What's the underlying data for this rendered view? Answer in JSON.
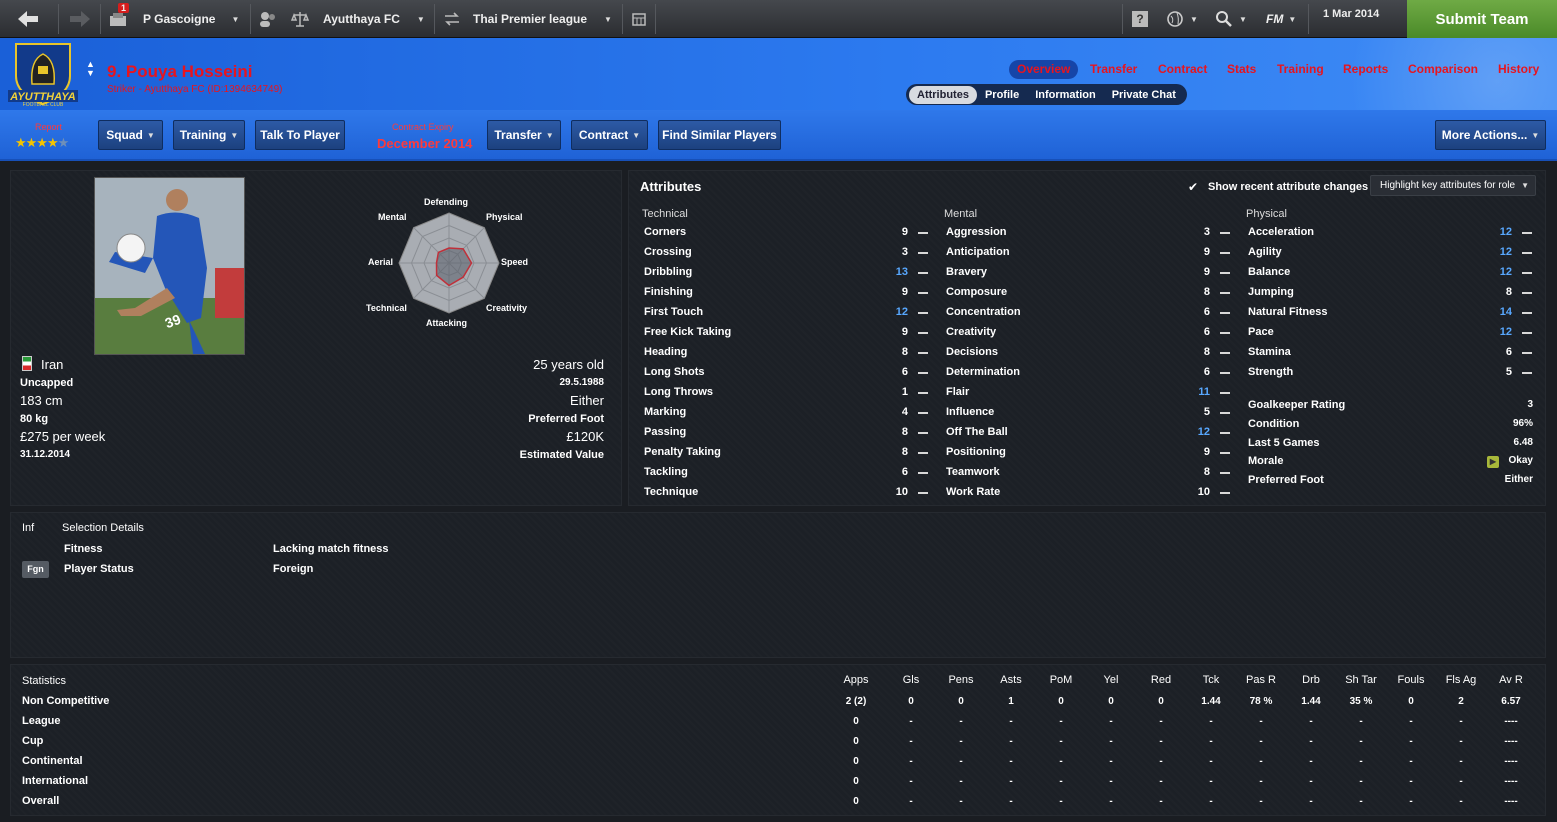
{
  "topbar": {
    "manager": "P Gascoigne",
    "club": "Ayutthaya FC",
    "competition": "Thai Premier league",
    "date": "1 Mar 2014",
    "fm_label": "FM",
    "submit": "Submit Team",
    "notification_count": "1"
  },
  "header": {
    "club_logo_text": "AYUTTHAYA",
    "club_logo_sub": "FOOTBALL CLUB",
    "player_name": "9. Pouya Hosseini",
    "player_sub": "Striker - Ayutthaya FC (ID:1394634749)",
    "tabs": [
      "Overview",
      "Transfer",
      "Contract",
      "Stats",
      "Training",
      "Reports",
      "Comparison",
      "History"
    ],
    "subtabs": [
      "Attributes",
      "Profile",
      "Information",
      "Private Chat"
    ]
  },
  "actions": {
    "report_label": "Report",
    "stars": "★★★★",
    "half_star": "★",
    "squad": "Squad",
    "training": "Training",
    "talk": "Talk To Player",
    "contract_expiry_label": "Contract Expiry",
    "contract_expiry": "December 2014",
    "transfer": "Transfer",
    "contract": "Contract",
    "similar": "Find Similar Players",
    "more": "More Actions..."
  },
  "profile": {
    "nationality": "Iran",
    "caps": "Uncapped",
    "height": "183 cm",
    "weight": "80 kg",
    "wage": "£275 per week",
    "contract_end": "31.12.2014",
    "age": "25 years old",
    "dob": "29.5.1988",
    "foot": "Either",
    "foot_label": "Preferred Foot",
    "value": "£120K",
    "value_label": "Estimated Value",
    "shirt_number": "39"
  },
  "radar": {
    "labels": [
      "Defending",
      "Physical",
      "Speed",
      "Creativity",
      "Attacking",
      "Technical",
      "Aerial",
      "Mental"
    ],
    "values": [
      0.3,
      0.4,
      0.45,
      0.4,
      0.45,
      0.35,
      0.25,
      0.3
    ]
  },
  "attributes": {
    "title": "Attributes",
    "show_changes": "Show recent attribute changes",
    "highlight": "Highlight key attributes for role",
    "technical_title": "Technical",
    "mental_title": "Mental",
    "physical_title": "Physical",
    "technical": [
      {
        "name": "Corners",
        "value": "9",
        "hl": false
      },
      {
        "name": "Crossing",
        "value": "3",
        "hl": false
      },
      {
        "name": "Dribbling",
        "value": "13",
        "hl": true
      },
      {
        "name": "Finishing",
        "value": "9",
        "hl": false
      },
      {
        "name": "First Touch",
        "value": "12",
        "hl": true
      },
      {
        "name": "Free Kick Taking",
        "value": "9",
        "hl": false
      },
      {
        "name": "Heading",
        "value": "8",
        "hl": false
      },
      {
        "name": "Long Shots",
        "value": "6",
        "hl": false
      },
      {
        "name": "Long Throws",
        "value": "1",
        "hl": false
      },
      {
        "name": "Marking",
        "value": "4",
        "hl": false
      },
      {
        "name": "Passing",
        "value": "8",
        "hl": false
      },
      {
        "name": "Penalty Taking",
        "value": "8",
        "hl": false
      },
      {
        "name": "Tackling",
        "value": "6",
        "hl": false
      },
      {
        "name": "Technique",
        "value": "10",
        "hl": false
      }
    ],
    "mental": [
      {
        "name": "Aggression",
        "value": "3",
        "hl": false
      },
      {
        "name": "Anticipation",
        "value": "9",
        "hl": false
      },
      {
        "name": "Bravery",
        "value": "9",
        "hl": false
      },
      {
        "name": "Composure",
        "value": "8",
        "hl": false
      },
      {
        "name": "Concentration",
        "value": "6",
        "hl": false
      },
      {
        "name": "Creativity",
        "value": "6",
        "hl": false
      },
      {
        "name": "Decisions",
        "value": "8",
        "hl": false
      },
      {
        "name": "Determination",
        "value": "6",
        "hl": false
      },
      {
        "name": "Flair",
        "value": "11",
        "hl": true
      },
      {
        "name": "Influence",
        "value": "5",
        "hl": false
      },
      {
        "name": "Off The Ball",
        "value": "12",
        "hl": true
      },
      {
        "name": "Positioning",
        "value": "9",
        "hl": false
      },
      {
        "name": "Teamwork",
        "value": "8",
        "hl": false
      },
      {
        "name": "Work Rate",
        "value": "10",
        "hl": false
      }
    ],
    "physical": [
      {
        "name": "Acceleration",
        "value": "12",
        "hl": true
      },
      {
        "name": "Agility",
        "value": "12",
        "hl": true
      },
      {
        "name": "Balance",
        "value": "12",
        "hl": true
      },
      {
        "name": "Jumping",
        "value": "8",
        "hl": false
      },
      {
        "name": "Natural Fitness",
        "value": "14",
        "hl": true
      },
      {
        "name": "Pace",
        "value": "12",
        "hl": true
      },
      {
        "name": "Stamina",
        "value": "6",
        "hl": false
      },
      {
        "name": "Strength",
        "value": "5",
        "hl": false
      }
    ],
    "extra": [
      {
        "name": "Goalkeeper Rating",
        "value": "3"
      },
      {
        "name": "Condition",
        "value": "96%"
      },
      {
        "name": "Last 5 Games",
        "value": "6.48"
      },
      {
        "name": "Morale",
        "value": "Okay"
      },
      {
        "name": "Preferred Foot",
        "value": "Either"
      }
    ]
  },
  "selection": {
    "inf": "Inf",
    "title": "Selection Details",
    "fitness_label": "Fitness",
    "fitness_value": "Lacking match fitness",
    "badge": "Fgn",
    "status_label": "Player Status",
    "status_value": "Foreign"
  },
  "statistics": {
    "title": "Statistics",
    "columns": [
      "Apps",
      "Gls",
      "Pens",
      "Asts",
      "PoM",
      "Yel",
      "Red",
      "Tck",
      "Pas R",
      "Drb",
      "Sh Tar",
      "Fouls",
      "Fls Ag",
      "Av R"
    ],
    "rows": [
      {
        "label": "Non Competitive",
        "cells": [
          "2 (2)",
          "0",
          "0",
          "1",
          "0",
          "0",
          "0",
          "1.44",
          "78 %",
          "1.44",
          "35 %",
          "0",
          "2",
          "6.57"
        ]
      },
      {
        "label": "League",
        "cells": [
          "0",
          "-",
          "-",
          "-",
          "-",
          "-",
          "-",
          "-",
          "-",
          "-",
          "-",
          "-",
          "-",
          "----"
        ]
      },
      {
        "label": "Cup",
        "cells": [
          "0",
          "-",
          "-",
          "-",
          "-",
          "-",
          "-",
          "-",
          "-",
          "-",
          "-",
          "-",
          "-",
          "----"
        ]
      },
      {
        "label": "Continental",
        "cells": [
          "0",
          "-",
          "-",
          "-",
          "-",
          "-",
          "-",
          "-",
          "-",
          "-",
          "-",
          "-",
          "-",
          "----"
        ]
      },
      {
        "label": "International",
        "cells": [
          "0",
          "-",
          "-",
          "-",
          "-",
          "-",
          "-",
          "-",
          "-",
          "-",
          "-",
          "-",
          "-",
          "----"
        ]
      },
      {
        "label": "Overall",
        "cells": [
          "0",
          "-",
          "-",
          "-",
          "-",
          "-",
          "-",
          "-",
          "-",
          "-",
          "-",
          "-",
          "-",
          "----"
        ]
      }
    ]
  }
}
